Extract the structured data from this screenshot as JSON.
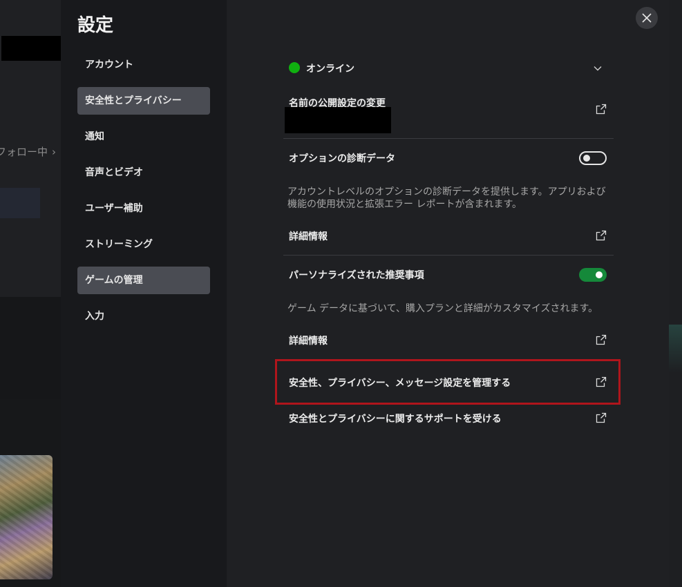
{
  "background": {
    "follow_text": "フォロー中",
    "follow_chevron": "›"
  },
  "settings": {
    "title": "設定",
    "close_icon": "close-icon"
  },
  "nav": {
    "items": [
      {
        "label": "アカウント",
        "active": false
      },
      {
        "label": "安全性とプライバシー",
        "active": true
      },
      {
        "label": "通知",
        "active": false
      },
      {
        "label": "音声とビデオ",
        "active": false
      },
      {
        "label": "ユーザー補助",
        "active": false
      },
      {
        "label": "ストリーミング",
        "active": false
      },
      {
        "label": "ゲームの管理",
        "active": true
      },
      {
        "label": "入力",
        "active": false
      }
    ]
  },
  "main": {
    "status": {
      "label": "オンライン",
      "color": "#10b010"
    },
    "name_visibility": {
      "label": "名前の公開設定の変更"
    },
    "diagnostics": {
      "label": "オプションの診断データ",
      "toggle": "off",
      "description": "アカウントレベルのオプションの診断データを提供します。アプリおよび機能の使用状況と拡張エラー レポートが含まれます。",
      "more_info": "詳細情報"
    },
    "recommendations": {
      "label": "パーソナライズされた推奨事項",
      "toggle": "on",
      "toggle_color": "#15893a",
      "description": "ゲーム データに基づいて、購入プランと詳細がカスタマイズされます。",
      "more_info": "詳細情報"
    },
    "manage_link": "安全性、プライバシー、メッセージ設定を管理する",
    "support_link": "安全性とプライバシーに関するサポートを受ける",
    "highlight_color": "#b0151c"
  }
}
